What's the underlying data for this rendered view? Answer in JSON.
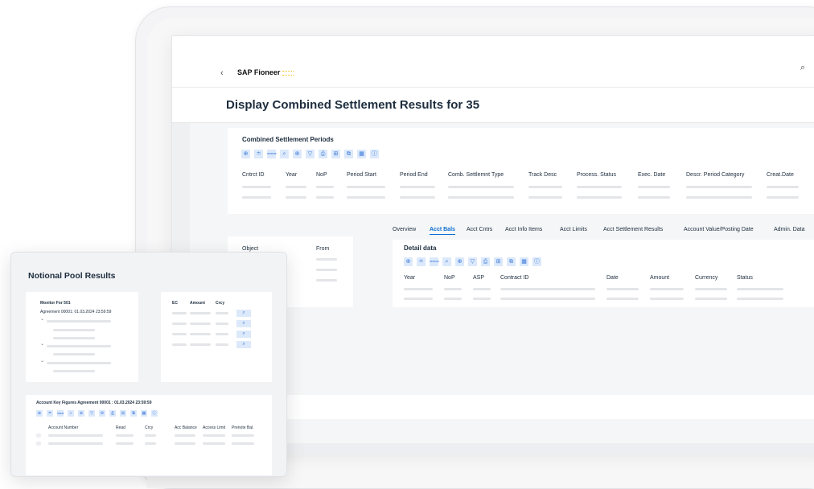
{
  "shell": {
    "back_icon": "‹",
    "brand_name": "SAP Fioneer",
    "search_icon": "⌕"
  },
  "page": {
    "title": "Display Combined Settlement Results for 35"
  },
  "periods": {
    "title": "Combined Settlement Periods",
    "toolbar": [
      "⊕",
      "≐",
      "⩶",
      "⌕",
      "⊕",
      "▽",
      "⎙",
      "⊞",
      "⧉",
      "▦",
      "ⓘ"
    ],
    "columns": [
      "Cntrct ID",
      "Year",
      "NoP",
      "Period Start",
      "Period End",
      "Comb. Settlemnt Type",
      "Track Desc",
      "Process. Status",
      "Exec. Date",
      "Descr. Period Category",
      "Creat.Date"
    ]
  },
  "object_panel": {
    "col1": "Object",
    "col2": "From"
  },
  "tabs": [
    "Overview",
    "Acct Bals",
    "Acct Cntrs",
    "Acct Info Items",
    "Acct Limits",
    "Acct Settlement Results",
    "Account Value/Posting Date",
    "Admin. Data"
  ],
  "active_tab": "Acct Bals",
  "detail": {
    "title": "Detail data",
    "toolbar": [
      "⊕",
      "≐",
      "⩶",
      "⌕",
      "⊕",
      "▽",
      "⎙",
      "⊞",
      "⧉",
      "▦",
      "ⓘ"
    ],
    "columns": [
      "Year",
      "NoP",
      "ASP",
      "Contract ID",
      "Date",
      "Amount",
      "Currency",
      "Status"
    ]
  },
  "notional": {
    "title": "Notional Pool Results",
    "monitor_title": "Monitor For 501",
    "agreement": "Agreement 00001: 01.03.2024 23:59:59",
    "mini_columns": [
      "EC",
      "Amount",
      "Crcy"
    ],
    "query_icon": "⌕",
    "key_figures_title": "Account Key Figures Agreement 00001 : 01.03.2024 23:59:59",
    "key_figures_toolbar": [
      "⊕",
      "≐",
      "⩶",
      "⌕",
      "⊕",
      "▽",
      "⚙",
      "⎙",
      "⊞",
      "⧉",
      "▦",
      "ⓘ"
    ],
    "key_figures_columns": [
      "Account Number",
      "Read",
      "Crcy",
      "Acc Balance",
      "Access Limit",
      "Prenote Bal."
    ]
  }
}
